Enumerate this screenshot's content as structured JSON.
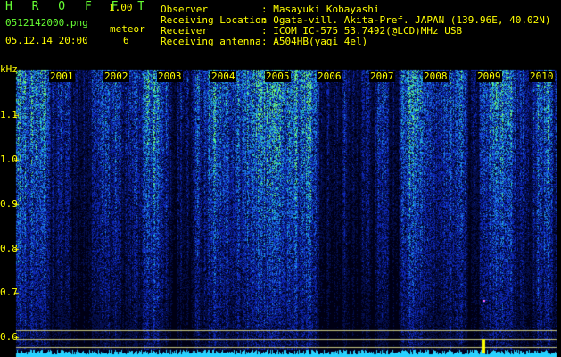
{
  "header": {
    "app_name": "H R O F F T",
    "version": "1.00",
    "filename": "0512142000.png",
    "datetime": "05.12.14 20:00",
    "meteor_label": "meteor",
    "meteor_count": "6"
  },
  "info": {
    "rows": [
      {
        "label": "Observer",
        "value": ": Masayuki Kobayashi"
      },
      {
        "label": "Receiving Location",
        "value": ": Ogata-vill. Akita-Pref. JAPAN (139.96E, 40.02N)"
      },
      {
        "label": "Receiver",
        "value": ": ICOM IC-575 53.7492(@LCD)MHz USB"
      },
      {
        "label": "Receiving antenna",
        "value": ": A504HB(yagi 4el)"
      }
    ]
  },
  "axis": {
    "unit": "kHz",
    "ticks": [
      "1.1",
      "1.0",
      "0.9",
      "0.8",
      "0.7",
      "0.6"
    ],
    "years": [
      "2001",
      "2002",
      "2003",
      "2004",
      "2005",
      "2006",
      "2007",
      "2008",
      "2009",
      "2010"
    ]
  },
  "colors": {
    "header_green": "#66ff33",
    "header_yellow": "#ffff00",
    "background": "#000000",
    "signal_low": "#0a1460",
    "signal_mid": "#2a6cff",
    "signal_high": "#88ff66",
    "baseline": "#33ddff"
  }
}
